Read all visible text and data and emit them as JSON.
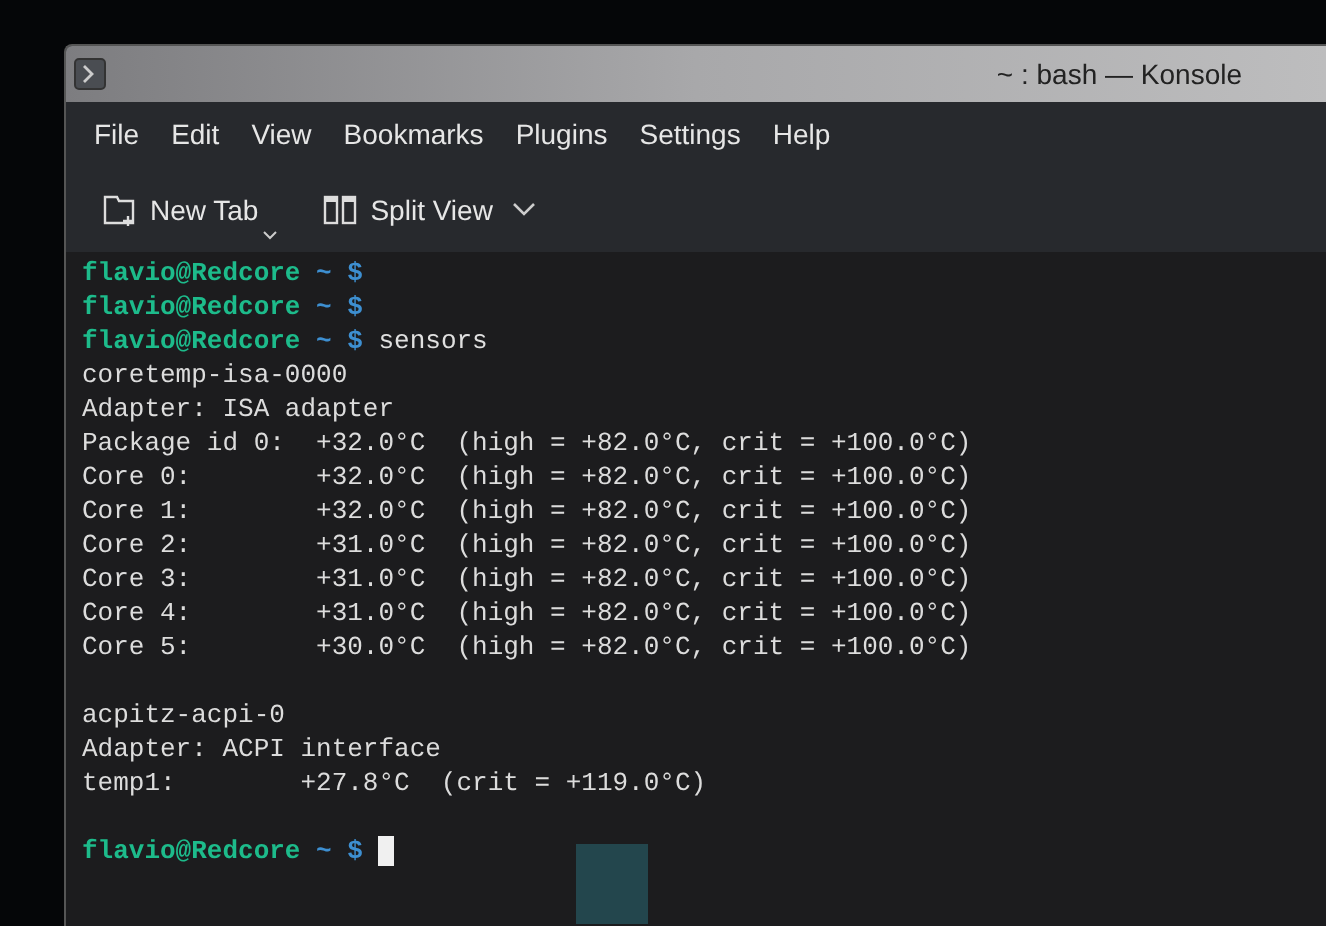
{
  "window": {
    "title": "~ : bash — Konsole"
  },
  "menu": [
    "File",
    "Edit",
    "View",
    "Bookmarks",
    "Plugins",
    "Settings",
    "Help"
  ],
  "toolbar": [
    {
      "kind": "newtab",
      "label": "New Tab"
    },
    {
      "kind": "split",
      "label": "Split View"
    }
  ],
  "terminal": [
    {
      "kind": "prompt",
      "user": "flavio@Redcore",
      "path": "~",
      "symbol": "$",
      "cursor": false
    },
    {
      "kind": "prompt",
      "user": "flavio@Redcore",
      "path": "~",
      "symbol": "$",
      "cursor": false
    },
    {
      "kind": "prompt",
      "user": "flavio@Redcore",
      "path": "~",
      "symbol": "$",
      "command": "sensors",
      "cursor": false
    },
    {
      "kind": "output",
      "text": "coretemp-isa-0000"
    },
    {
      "kind": "output",
      "text": "Adapter: ISA adapter"
    },
    {
      "kind": "output",
      "text": "Package id 0:  +32.0°C  (high = +82.0°C, crit = +100.0°C)"
    },
    {
      "kind": "output",
      "text": "Core 0:        +32.0°C  (high = +82.0°C, crit = +100.0°C)"
    },
    {
      "kind": "output",
      "text": "Core 1:        +32.0°C  (high = +82.0°C, crit = +100.0°C)"
    },
    {
      "kind": "output",
      "text": "Core 2:        +31.0°C  (high = +82.0°C, crit = +100.0°C)"
    },
    {
      "kind": "output",
      "text": "Core 3:        +31.0°C  (high = +82.0°C, crit = +100.0°C)"
    },
    {
      "kind": "output",
      "text": "Core 4:        +31.0°C  (high = +82.0°C, crit = +100.0°C)"
    },
    {
      "kind": "output",
      "text": "Core 5:        +30.0°C  (high = +82.0°C, crit = +100.0°C)"
    },
    {
      "kind": "blank"
    },
    {
      "kind": "output",
      "text": "acpitz-acpi-0"
    },
    {
      "kind": "output",
      "text": "Adapter: ACPI interface"
    },
    {
      "kind": "output",
      "text": "temp1:        +27.8°C  (crit = +119.0°C)"
    },
    {
      "kind": "blank"
    },
    {
      "kind": "prompt",
      "user": "flavio@Redcore",
      "path": "~",
      "symbol": "$",
      "cursor": true
    }
  ]
}
